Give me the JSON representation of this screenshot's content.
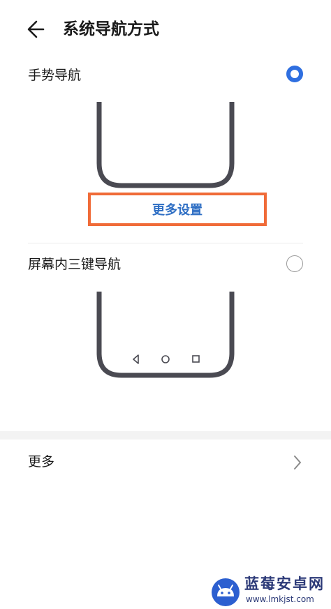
{
  "header": {
    "title": "系统导航方式",
    "back_icon": "arrow-left-icon"
  },
  "options": [
    {
      "label": "手势导航",
      "selected": true,
      "more_settings_label": "更多设置"
    },
    {
      "label": "屏幕内三键导航",
      "selected": false,
      "nav_keys": [
        "back-triangle-icon",
        "home-circle-icon",
        "recents-square-icon"
      ]
    }
  ],
  "more": {
    "label": "更多",
    "icon": "chevron-right-icon"
  },
  "watermark": {
    "title": "蓝莓安卓网",
    "url": "www.lmkjst.com"
  },
  "colors": {
    "accent": "#2f6fe0",
    "link": "#2f6fc4",
    "highlight": "#f06b38",
    "phone_frame": "#4a4a52"
  }
}
